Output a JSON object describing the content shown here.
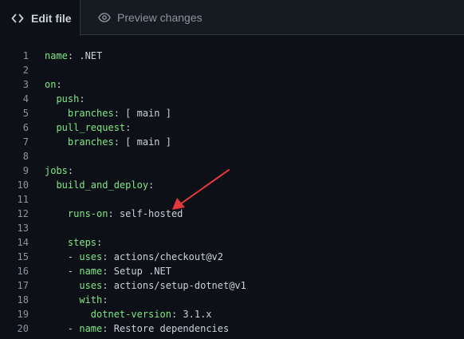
{
  "tabs": [
    {
      "label": "Edit file",
      "icon": "code-icon",
      "active": true
    },
    {
      "label": "Preview changes",
      "icon": "eye-icon",
      "active": false
    }
  ],
  "code": {
    "lines": [
      {
        "number": "1",
        "indent": "",
        "key": "name",
        "sep": ": ",
        "value": ".NET"
      },
      {
        "number": "2",
        "indent": "",
        "key": "",
        "sep": "",
        "value": ""
      },
      {
        "number": "3",
        "indent": "",
        "key": "on",
        "sep": ":",
        "value": ""
      },
      {
        "number": "4",
        "indent": "  ",
        "key": "push",
        "sep": ":",
        "value": ""
      },
      {
        "number": "5",
        "indent": "    ",
        "key": "branches",
        "sep": ": ",
        "value": "[ main ]"
      },
      {
        "number": "6",
        "indent": "  ",
        "key": "pull_request",
        "sep": ":",
        "value": ""
      },
      {
        "number": "7",
        "indent": "    ",
        "key": "branches",
        "sep": ": ",
        "value": "[ main ]"
      },
      {
        "number": "8",
        "indent": "",
        "key": "",
        "sep": "",
        "value": ""
      },
      {
        "number": "9",
        "indent": "",
        "key": "jobs",
        "sep": ":",
        "value": ""
      },
      {
        "number": "10",
        "indent": "  ",
        "key": "build_and_deploy",
        "sep": ":",
        "value": ""
      },
      {
        "number": "11",
        "indent": "",
        "key": "",
        "sep": "",
        "value": ""
      },
      {
        "number": "12",
        "indent": "    ",
        "key": "runs-on",
        "sep": ": ",
        "value": "self-hosted"
      },
      {
        "number": "13",
        "indent": "",
        "key": "",
        "sep": "",
        "value": ""
      },
      {
        "number": "14",
        "indent": "    ",
        "key": "steps",
        "sep": ":",
        "value": ""
      },
      {
        "number": "15",
        "indent": "    - ",
        "key": "uses",
        "sep": ": ",
        "value": "actions/checkout@v2"
      },
      {
        "number": "16",
        "indent": "    - ",
        "key": "name",
        "sep": ": ",
        "value": "Setup .NET"
      },
      {
        "number": "17",
        "indent": "      ",
        "key": "uses",
        "sep": ": ",
        "value": "actions/setup-dotnet@v1"
      },
      {
        "number": "18",
        "indent": "      ",
        "key": "with",
        "sep": ":",
        "value": ""
      },
      {
        "number": "19",
        "indent": "        ",
        "key": "dotnet-version",
        "sep": ": ",
        "value": "3.1.x"
      },
      {
        "number": "20",
        "indent": "    - ",
        "key": "name",
        "sep": ": ",
        "value": "Restore dependencies"
      }
    ]
  },
  "annotation": {
    "color": "#e5383b",
    "target_line": "12"
  },
  "colors": {
    "background": "#0d1117",
    "tabbar": "#161b22",
    "key": "#7ee787",
    "text": "#c9d1d9",
    "line_number": "#8b949e"
  }
}
